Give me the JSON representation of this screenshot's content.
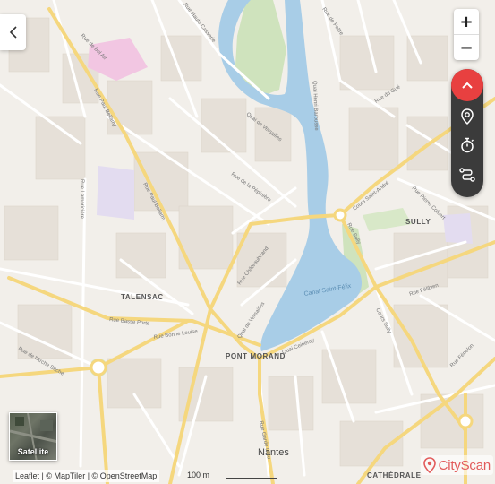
{
  "controls": {
    "zoom_in": "+",
    "zoom_out": "−",
    "satellite_label": "Satellite"
  },
  "attribution": {
    "leaflet": "Leaflet",
    "sep": " | © ",
    "maptiler": "MapTiler",
    "osm": "OpenStreetMap"
  },
  "scale": {
    "label": "100 m"
  },
  "brand": {
    "name": "CityScan"
  },
  "colors": {
    "water": "#a8cde7",
    "park": "#cfe3bd",
    "road_major": "#f5d77e",
    "background": "#f2efea",
    "accent": "#e84040"
  },
  "map": {
    "districts": [
      "TALENSAC",
      "PONT MORAND",
      "SULLY",
      "CATHÉDRALE"
    ],
    "city": "Nantes",
    "streets": [
      "Rue Paul Bellamy",
      "Rue de la Pépinière",
      "Rue Basse Porte",
      "Rue Bonne Louise",
      "Quai de Versailles",
      "Quai Ceineray",
      "Rue Sully",
      "Rue Félibien",
      "Cours Saint-André",
      "Rue du Gué",
      "Rue de l'Arche Sèche",
      "Rue Lamoricière",
      "Quai de Versailles",
      "Rue Garde Dieu",
      "Rue Châteaubriand",
      "Rue Haute Casserie",
      "Rue de Bel Air",
      "Quai Henri Barbusse",
      "Rue Pierre Colbert",
      "Rue de Feltre",
      "Cours Sully",
      "Rue Fénelon"
    ],
    "water_label": "Canal Saint-Félix"
  }
}
